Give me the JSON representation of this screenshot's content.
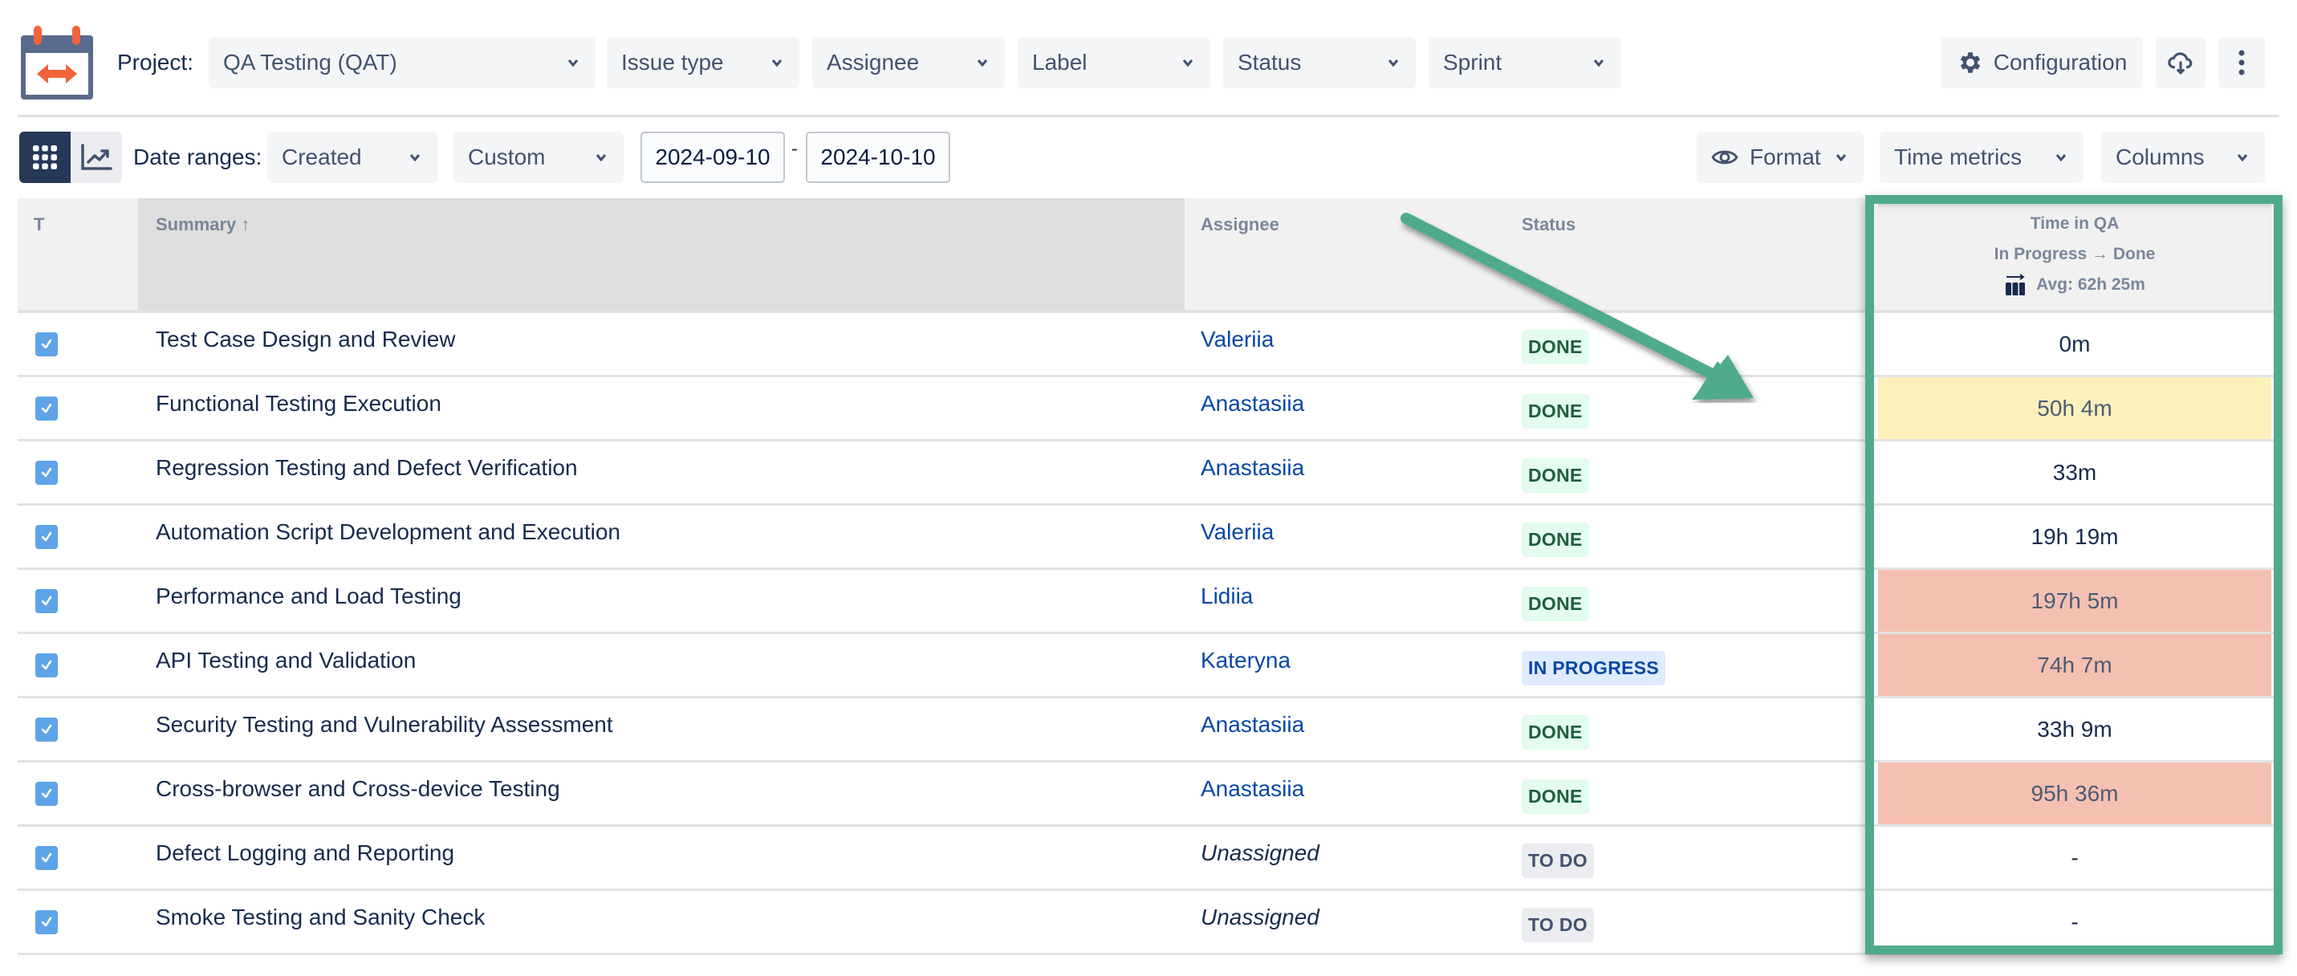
{
  "toolbar": {
    "project_label": "Project:",
    "project_value": "QA Testing (QAT)",
    "filters": [
      "Issue type",
      "Assignee",
      "Label",
      "Status",
      "Sprint"
    ],
    "configuration_label": "Configuration",
    "icons": {
      "logo": "calendar-arrow-logo-icon",
      "configuration": "gear-icon",
      "export": "cloud-download-icon",
      "more": "more-vertical-icon"
    }
  },
  "subbar": {
    "view_toggle": [
      "grid-view-icon",
      "chart-view-icon"
    ],
    "date_ranges_label": "Date ranges:",
    "date_field": "Created",
    "range_type": "Custom",
    "date_from": "2024-09-10",
    "date_separator": "-",
    "date_to": "2024-10-10",
    "format_label": "Format",
    "time_metrics_label": "Time metrics",
    "columns_label": "Columns"
  },
  "table": {
    "headers": {
      "type": "T",
      "summary": "Summary",
      "summary_sort": "↑",
      "assignee": "Assignee",
      "status": "Status",
      "time_title": "Time in QA",
      "time_transition": "In Progress → Done",
      "time_avg": "Avg: 62h 25m"
    },
    "rows": [
      {
        "summary": "Test Case Design and Review",
        "assignee": "Valeriia",
        "status": "DONE",
        "time": "0m",
        "highlight": "none"
      },
      {
        "summary": "Functional Testing Execution",
        "assignee": "Anastasiia",
        "status": "DONE",
        "time": "50h 4m",
        "highlight": "warn"
      },
      {
        "summary": "Regression Testing and Defect Verification",
        "assignee": "Anastasiia",
        "status": "DONE",
        "time": "33m",
        "highlight": "none"
      },
      {
        "summary": "Automation Script Development and Execution",
        "assignee": "Valeriia",
        "status": "DONE",
        "time": "19h 19m",
        "highlight": "none"
      },
      {
        "summary": "Performance and Load Testing",
        "assignee": "Lidiia",
        "status": "DONE",
        "time": "197h 5m",
        "highlight": "bad"
      },
      {
        "summary": "API Testing and Validation",
        "assignee": "Kateryna",
        "status": "IN PROGRESS",
        "time": "74h 7m",
        "highlight": "bad"
      },
      {
        "summary": "Security Testing and Vulnerability Assessment",
        "assignee": "Anastasiia",
        "status": "DONE",
        "time": "33h 9m",
        "highlight": "none"
      },
      {
        "summary": "Cross-browser and Cross-device Testing",
        "assignee": "Anastasiia",
        "status": "DONE",
        "time": "95h 36m",
        "highlight": "bad"
      },
      {
        "summary": "Defect Logging and Reporting",
        "assignee": "Unassigned",
        "status": "TO DO",
        "time": "-",
        "highlight": "none"
      },
      {
        "summary": "Smoke Testing and Sanity Check",
        "assignee": "Unassigned",
        "status": "TO DO",
        "time": "-",
        "highlight": "none"
      }
    ]
  },
  "colors": {
    "accent_annotation": "#4fab8c",
    "warn_cell": "#fcf0bb",
    "bad_cell": "#f4c0b1",
    "link": "#0747a6",
    "done_bg": "#e3fcef",
    "in_progress_bg": "#deebff",
    "todo_bg": "#ebecf0"
  }
}
